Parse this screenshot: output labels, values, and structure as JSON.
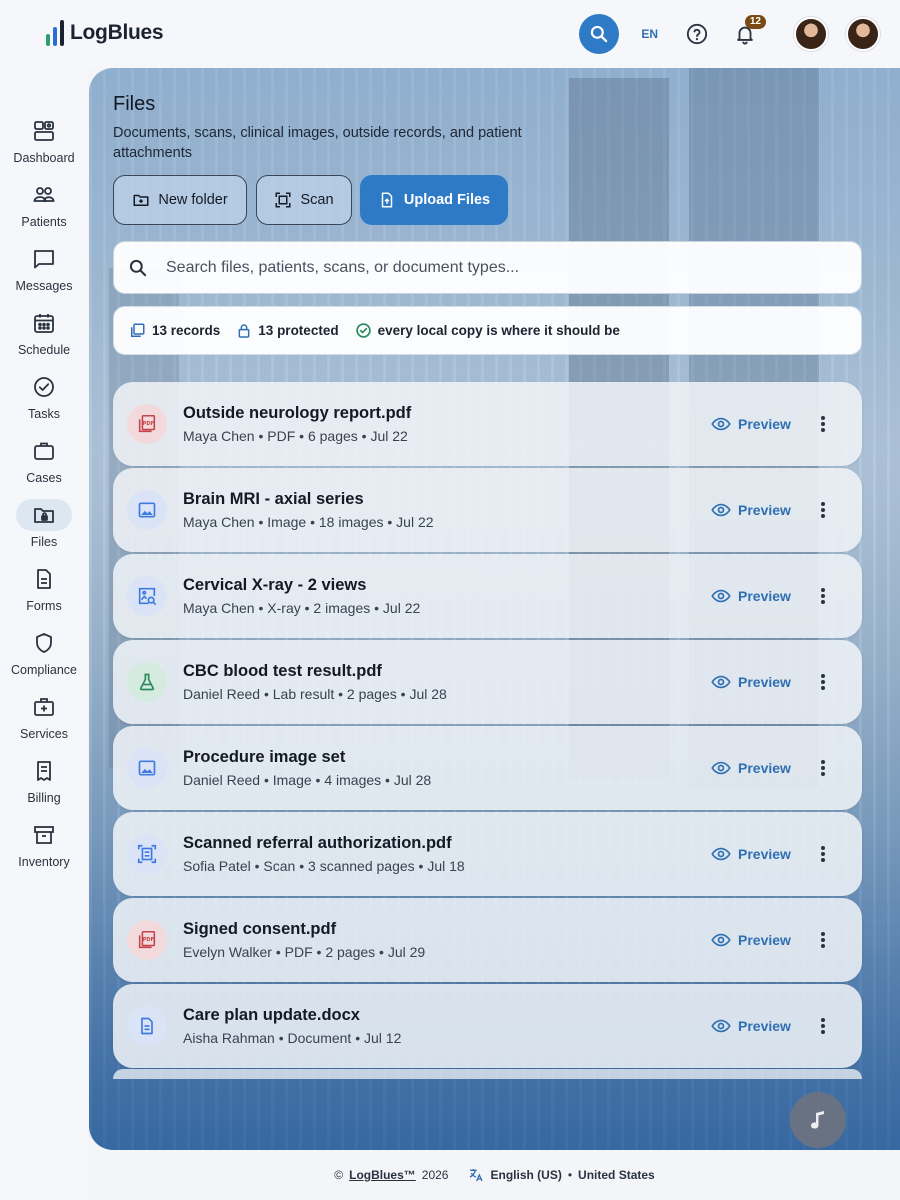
{
  "app": {
    "brand": "LogBlues"
  },
  "header": {
    "lang": "EN",
    "notification_count": "12"
  },
  "sidebar": {
    "items": [
      {
        "label": "Dashboard"
      },
      {
        "label": "Patients"
      },
      {
        "label": "Messages"
      },
      {
        "label": "Schedule"
      },
      {
        "label": "Tasks"
      },
      {
        "label": "Cases"
      },
      {
        "label": "Files"
      },
      {
        "label": "Forms"
      },
      {
        "label": "Compliance"
      },
      {
        "label": "Services"
      },
      {
        "label": "Billing"
      },
      {
        "label": "Inventory"
      }
    ],
    "active": "Files"
  },
  "main": {
    "title": "Files",
    "subtitle": "Documents, scans, clinical images, outside records, and patient attachments",
    "buttons": {
      "new_folder": "New folder",
      "scan": "Scan",
      "upload": "Upload Files"
    },
    "search": {
      "placeholder": "Search files, patients, scans, or document types..."
    },
    "status": {
      "records": "13 records",
      "protected": "13 protected",
      "integrity": "every local copy is where it should be"
    },
    "preview_label": "Preview",
    "files": [
      {
        "name": "Outside neurology report.pdf",
        "patient": "Maya Chen",
        "type": "PDF",
        "size": "6 pages",
        "date": "Jul 22",
        "icon": "pdf-icon"
      },
      {
        "name": "Brain MRI - axial series",
        "patient": "Maya Chen",
        "type": "Image",
        "size": "18 images",
        "date": "Jul 22",
        "icon": "image-icon"
      },
      {
        "name": "Cervical X-ray - 2 views",
        "patient": "Maya Chen",
        "type": "X-ray",
        "size": "2 images",
        "date": "Jul 22",
        "icon": "image-search-icon"
      },
      {
        "name": "CBC blood test result.pdf",
        "patient": "Daniel Reed",
        "type": "Lab result",
        "size": "2 pages",
        "date": "Jul 28",
        "icon": "flask-icon"
      },
      {
        "name": "Procedure image set",
        "patient": "Daniel Reed",
        "type": "Image",
        "size": "4 images",
        "date": "Jul 28",
        "icon": "image-icon"
      },
      {
        "name": "Scanned referral authorization.pdf",
        "patient": "Sofia Patel",
        "type": "Scan",
        "size": "3 scanned pages",
        "date": "Jul 18",
        "icon": "scan-document-icon"
      },
      {
        "name": "Signed consent.pdf",
        "patient": "Evelyn Walker",
        "type": "PDF",
        "size": "2 pages",
        "date": "Jul 29",
        "icon": "pdf-icon"
      },
      {
        "name": "Care plan update.docx",
        "patient": "Aisha Rahman",
        "type": "Document",
        "size": "Jul 12",
        "date": "",
        "icon": "document-icon"
      }
    ]
  },
  "footer": {
    "copyright": "©",
    "brand": "LogBlues™",
    "year": "2026",
    "language": "English (US)",
    "region": "United States"
  },
  "colors": {
    "accent": "#2f7ac6",
    "link": "#2f6fb3",
    "pdf": "#c5434a",
    "image": "#3f7ae0",
    "lab": "#2e8a5f"
  }
}
